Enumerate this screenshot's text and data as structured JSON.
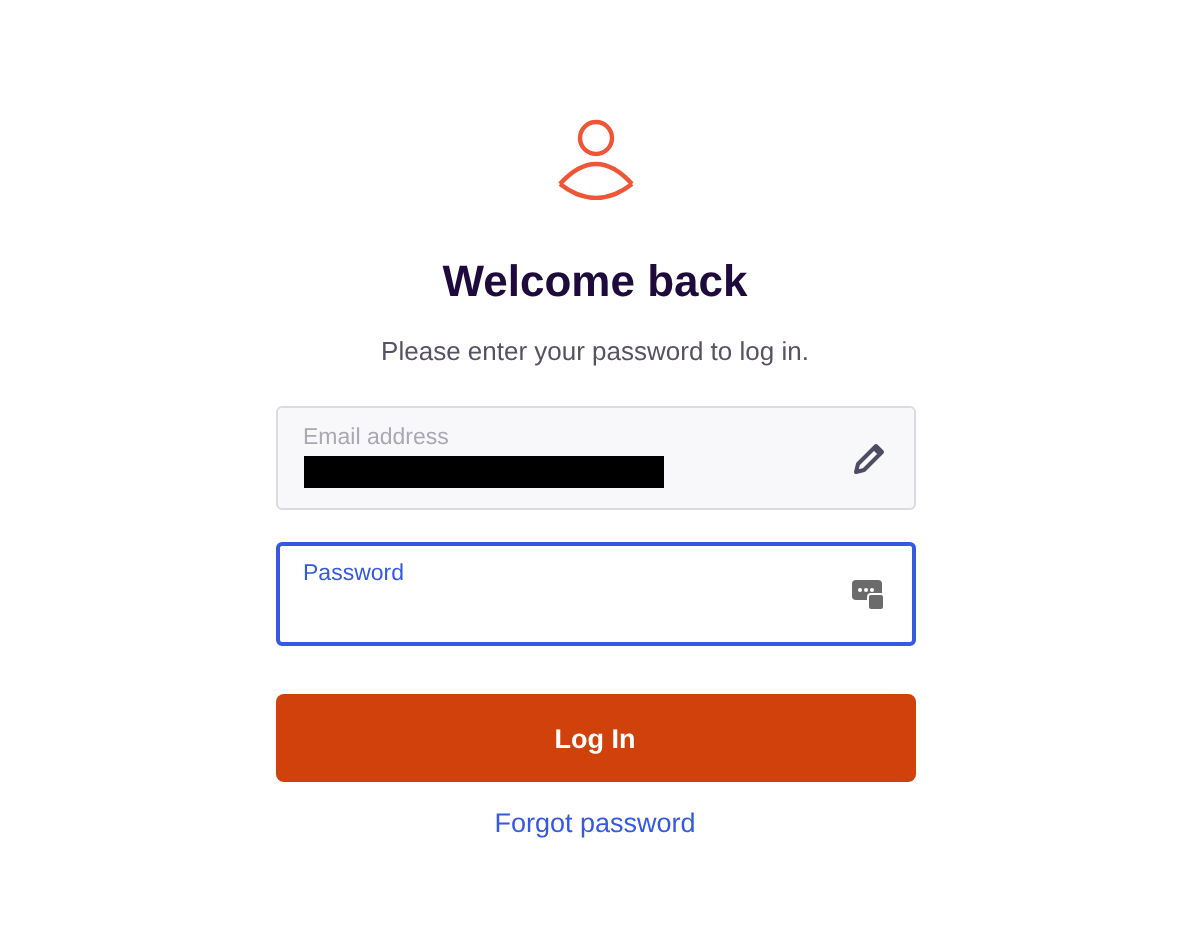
{
  "title": "Welcome back",
  "subtitle": "Please enter your password to log in.",
  "fields": [
    {
      "kind": "email",
      "label": "Email address",
      "disabled": true,
      "focused": false,
      "redacted": true
    },
    {
      "kind": "password",
      "label": "Password",
      "disabled": false,
      "focused": true,
      "redacted": false
    }
  ],
  "login_button": "Log In",
  "forgot_link": "Forgot password"
}
